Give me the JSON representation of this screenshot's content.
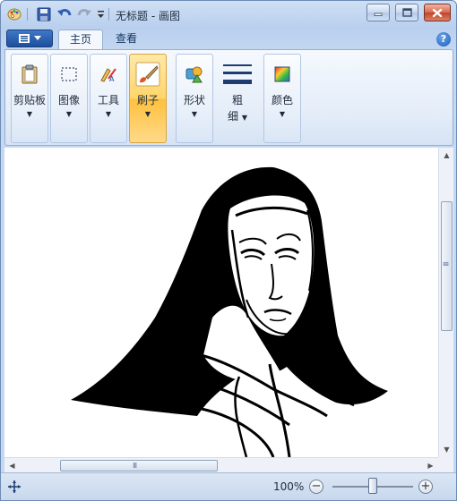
{
  "window": {
    "title": "无标题 - 画图"
  },
  "tabs": [
    {
      "label": "主页",
      "active": true
    },
    {
      "label": "查看",
      "active": false
    }
  ],
  "help_label": "?",
  "ribbon": {
    "groups": [
      {
        "label": "剪贴板",
        "icon": "clipboard-icon"
      },
      {
        "label": "图像",
        "icon": "select-icon"
      },
      {
        "label": "工具",
        "icon": "tools-icon"
      },
      {
        "label": "刷子",
        "icon": "brush-icon",
        "active": true
      },
      {
        "label": "形状",
        "icon": "shapes-icon"
      },
      {
        "label": "粗",
        "label2": "细",
        "icon": "line-width-icon"
      },
      {
        "label": "颜色",
        "icon": "color-icon"
      }
    ]
  },
  "scrollbar_grip": "III",
  "statusbar": {
    "zoom_text": "100%",
    "zoom_level_percent": 100,
    "zoom_out": "−",
    "zoom_in": "+"
  },
  "colors": {
    "accent": "#ffc13d",
    "frame": "#b9cfee",
    "ink": "#000000"
  }
}
